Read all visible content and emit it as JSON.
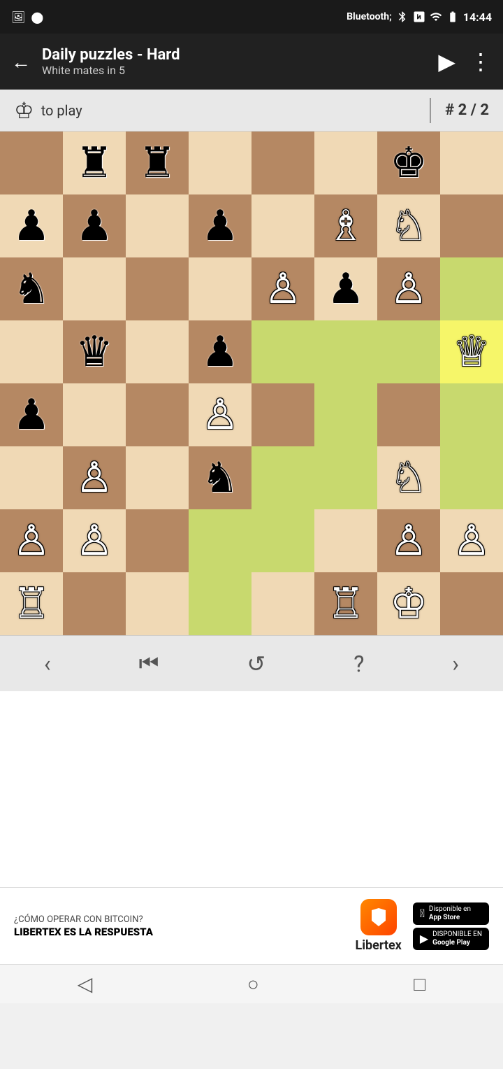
{
  "statusBar": {
    "time": "14:44",
    "leftIcons": [
      "🖼",
      "●"
    ]
  },
  "appBar": {
    "title": "Daily puzzles - Hard",
    "subtitle": "White mates in 5",
    "backLabel": "←"
  },
  "subHeader": {
    "pieceSymbol": "♔",
    "toPlayLabel": "to play",
    "puzzleNumber": "# 2 / 2"
  },
  "board": {
    "description": "8x8 chess board",
    "cells": [
      {
        "row": 0,
        "col": 0,
        "color": "dark",
        "piece": "",
        "highlight": ""
      },
      {
        "row": 0,
        "col": 1,
        "color": "light",
        "piece": "♜",
        "highlight": ""
      },
      {
        "row": 0,
        "col": 2,
        "color": "dark",
        "piece": "♜",
        "highlight": ""
      },
      {
        "row": 0,
        "col": 3,
        "color": "light",
        "piece": "",
        "highlight": ""
      },
      {
        "row": 0,
        "col": 4,
        "color": "dark",
        "piece": "",
        "highlight": ""
      },
      {
        "row": 0,
        "col": 5,
        "color": "light",
        "piece": "",
        "highlight": ""
      },
      {
        "row": 0,
        "col": 6,
        "color": "dark",
        "piece": "♚",
        "highlight": ""
      },
      {
        "row": 0,
        "col": 7,
        "color": "light",
        "piece": "",
        "highlight": ""
      },
      {
        "row": 1,
        "col": 0,
        "color": "light",
        "piece": "♟",
        "highlight": ""
      },
      {
        "row": 1,
        "col": 1,
        "color": "dark",
        "piece": "♟",
        "highlight": ""
      },
      {
        "row": 1,
        "col": 2,
        "color": "light",
        "piece": "",
        "highlight": ""
      },
      {
        "row": 1,
        "col": 3,
        "color": "dark",
        "piece": "♟",
        "highlight": ""
      },
      {
        "row": 1,
        "col": 4,
        "color": "light",
        "piece": "",
        "highlight": ""
      },
      {
        "row": 1,
        "col": 5,
        "color": "dark",
        "piece": "♗",
        "highlight": ""
      },
      {
        "row": 1,
        "col": 6,
        "color": "light",
        "piece": "♘",
        "highlight": ""
      },
      {
        "row": 1,
        "col": 7,
        "color": "dark",
        "piece": "",
        "highlight": ""
      },
      {
        "row": 2,
        "col": 0,
        "color": "dark",
        "piece": "♞",
        "highlight": ""
      },
      {
        "row": 2,
        "col": 1,
        "color": "light",
        "piece": "",
        "highlight": ""
      },
      {
        "row": 2,
        "col": 2,
        "color": "dark",
        "piece": "",
        "highlight": ""
      },
      {
        "row": 2,
        "col": 3,
        "color": "light",
        "piece": "",
        "highlight": ""
      },
      {
        "row": 2,
        "col": 4,
        "color": "dark",
        "piece": "♙",
        "highlight": ""
      },
      {
        "row": 2,
        "col": 5,
        "color": "light",
        "piece": "♟",
        "highlight": ""
      },
      {
        "row": 2,
        "col": 6,
        "color": "dark",
        "piece": "♙",
        "highlight": ""
      },
      {
        "row": 2,
        "col": 7,
        "color": "light",
        "piece": "",
        "highlight": "green"
      },
      {
        "row": 3,
        "col": 0,
        "color": "light",
        "piece": "",
        "highlight": ""
      },
      {
        "row": 3,
        "col": 1,
        "color": "dark",
        "piece": "♛",
        "highlight": ""
      },
      {
        "row": 3,
        "col": 2,
        "color": "light",
        "piece": "",
        "highlight": ""
      },
      {
        "row": 3,
        "col": 3,
        "color": "dark",
        "piece": "♟",
        "highlight": ""
      },
      {
        "row": 3,
        "col": 4,
        "color": "light",
        "piece": "",
        "highlight": "green"
      },
      {
        "row": 3,
        "col": 5,
        "color": "dark",
        "piece": "",
        "highlight": "green"
      },
      {
        "row": 3,
        "col": 6,
        "color": "light",
        "piece": "",
        "highlight": "green"
      },
      {
        "row": 3,
        "col": 7,
        "color": "dark",
        "piece": "♕",
        "highlight": "yellow"
      },
      {
        "row": 4,
        "col": 0,
        "color": "dark",
        "piece": "♟",
        "highlight": ""
      },
      {
        "row": 4,
        "col": 1,
        "color": "light",
        "piece": "",
        "highlight": ""
      },
      {
        "row": 4,
        "col": 2,
        "color": "dark",
        "piece": "",
        "highlight": ""
      },
      {
        "row": 4,
        "col": 3,
        "color": "light",
        "piece": "♙",
        "highlight": ""
      },
      {
        "row": 4,
        "col": 4,
        "color": "dark",
        "piece": "",
        "highlight": ""
      },
      {
        "row": 4,
        "col": 5,
        "color": "light",
        "piece": "",
        "highlight": "green"
      },
      {
        "row": 4,
        "col": 6,
        "color": "dark",
        "piece": "",
        "highlight": ""
      },
      {
        "row": 4,
        "col": 7,
        "color": "light",
        "piece": "",
        "highlight": "green"
      },
      {
        "row": 5,
        "col": 0,
        "color": "light",
        "piece": "",
        "highlight": ""
      },
      {
        "row": 5,
        "col": 1,
        "color": "dark",
        "piece": "♙",
        "highlight": ""
      },
      {
        "row": 5,
        "col": 2,
        "color": "light",
        "piece": "",
        "highlight": ""
      },
      {
        "row": 5,
        "col": 3,
        "color": "dark",
        "piece": "♞",
        "highlight": ""
      },
      {
        "row": 5,
        "col": 4,
        "color": "light",
        "piece": "",
        "highlight": "green"
      },
      {
        "row": 5,
        "col": 5,
        "color": "dark",
        "piece": "",
        "highlight": "green"
      },
      {
        "row": 5,
        "col": 6,
        "color": "light",
        "piece": "♘",
        "highlight": ""
      },
      {
        "row": 5,
        "col": 7,
        "color": "dark",
        "piece": "",
        "highlight": "green"
      },
      {
        "row": 6,
        "col": 0,
        "color": "dark",
        "piece": "♙",
        "highlight": ""
      },
      {
        "row": 6,
        "col": 1,
        "color": "light",
        "piece": "♙",
        "highlight": ""
      },
      {
        "row": 6,
        "col": 2,
        "color": "dark",
        "piece": "",
        "highlight": ""
      },
      {
        "row": 6,
        "col": 3,
        "color": "light",
        "piece": "",
        "highlight": "green"
      },
      {
        "row": 6,
        "col": 4,
        "color": "dark",
        "piece": "",
        "highlight": "green"
      },
      {
        "row": 6,
        "col": 5,
        "color": "light",
        "piece": "",
        "highlight": ""
      },
      {
        "row": 6,
        "col": 6,
        "color": "dark",
        "piece": "♙",
        "highlight": ""
      },
      {
        "row": 6,
        "col": 7,
        "color": "light",
        "piece": "♙",
        "highlight": ""
      },
      {
        "row": 7,
        "col": 0,
        "color": "light",
        "piece": "♖",
        "highlight": ""
      },
      {
        "row": 7,
        "col": 1,
        "color": "dark",
        "piece": "",
        "highlight": ""
      },
      {
        "row": 7,
        "col": 2,
        "color": "light",
        "piece": "",
        "highlight": ""
      },
      {
        "row": 7,
        "col": 3,
        "color": "dark",
        "piece": "",
        "highlight": "green"
      },
      {
        "row": 7,
        "col": 4,
        "color": "light",
        "piece": "",
        "highlight": ""
      },
      {
        "row": 7,
        "col": 5,
        "color": "dark",
        "piece": "♖",
        "highlight": ""
      },
      {
        "row": 7,
        "col": 6,
        "color": "light",
        "piece": "♔",
        "highlight": ""
      },
      {
        "row": 7,
        "col": 7,
        "color": "dark",
        "piece": "",
        "highlight": ""
      }
    ]
  },
  "navBar": {
    "prevLabel": "‹",
    "rewindLabel": "⏮",
    "undoLabel": "↺",
    "hintLabel": "?",
    "nextLabel": "›"
  },
  "ad": {
    "line1": "¿CÓMO OPERAR CON BITCOIN?",
    "line2": "LIBERTEX ES LA RESPUESTA",
    "brandName": "Libertex",
    "appStore": "Disponible en\nApp Store",
    "googlePlay": "Disponible en\nGoogle Play"
  },
  "bottomNav": {
    "backLabel": "◁",
    "homeLabel": "○",
    "recentLabel": "□"
  }
}
